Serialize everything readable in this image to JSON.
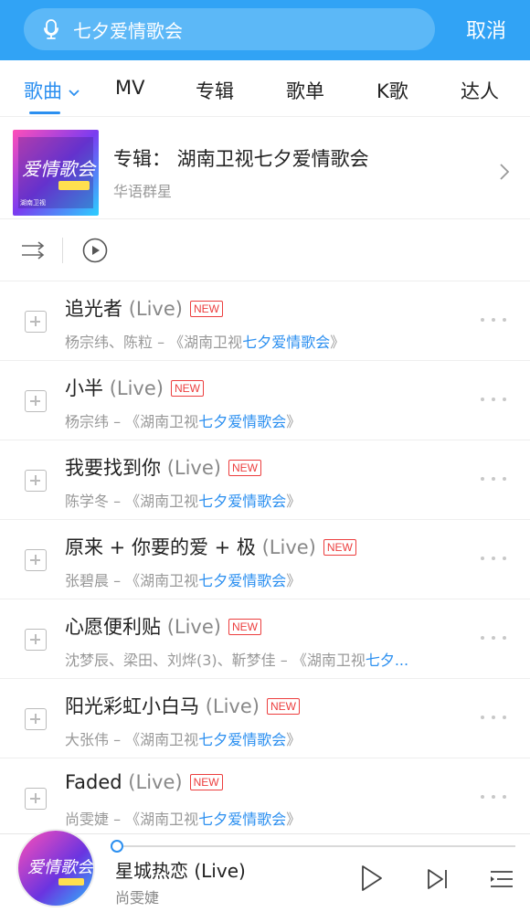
{
  "search": {
    "query": "七夕爱情歌会",
    "cancel_label": "取消"
  },
  "tabs": [
    {
      "label": "歌曲"
    },
    {
      "label": "MV"
    },
    {
      "label": "专辑"
    },
    {
      "label": "歌单"
    },
    {
      "label": "K歌"
    },
    {
      "label": "达人"
    }
  ],
  "album": {
    "title": "专辑： 湖南卫视七夕爱情歌会",
    "artist": "华语群星",
    "cover_text": "爱情歌会",
    "cover_sub": "湖南卫视"
  },
  "songs": [
    {
      "title": "追光者",
      "live": "(Live)",
      "badge": "NEW",
      "artists": "杨宗纬、陈粒 – 《湖南卫视",
      "album_hl": "七夕爱情歌会",
      "album_end": "》"
    },
    {
      "title": "小半",
      "live": "(Live)",
      "badge": "NEW",
      "artists": "杨宗纬 – 《湖南卫视",
      "album_hl": "七夕爱情歌会",
      "album_end": "》"
    },
    {
      "title": "我要找到你",
      "live": "(Live)",
      "badge": "NEW",
      "artists": "陈学冬 – 《湖南卫视",
      "album_hl": "七夕爱情歌会",
      "album_end": "》"
    },
    {
      "title": "原来 + 你要的爱 + 极",
      "live": "(Live)",
      "badge": "NEW",
      "artists": "张碧晨 – 《湖南卫视",
      "album_hl": "七夕爱情歌会",
      "album_end": "》"
    },
    {
      "title": "心愿便利贴",
      "live": "(Live)",
      "badge": "NEW",
      "artists": "沈梦辰、梁田、刘烨(3)、靳梦佳 – 《湖南卫视",
      "album_hl": "七夕...",
      "album_end": ""
    },
    {
      "title": "阳光彩虹小白马",
      "live": "(Live)",
      "badge": "NEW",
      "artists": "大张伟 – 《湖南卫视",
      "album_hl": "七夕爱情歌会",
      "album_end": "》"
    },
    {
      "title": "Faded",
      "live": "(Live)",
      "badge": "NEW",
      "artists": "尚雯婕 – 《湖南卫视",
      "album_hl": "七夕爱情歌会",
      "album_end": "》"
    }
  ],
  "player": {
    "title": "星城热恋 (Live)",
    "artist": "尚雯婕",
    "progress": 0
  },
  "colors": {
    "header": "#31a3f5",
    "accent": "#2b8ff0",
    "badge": "#ec3e3e"
  }
}
